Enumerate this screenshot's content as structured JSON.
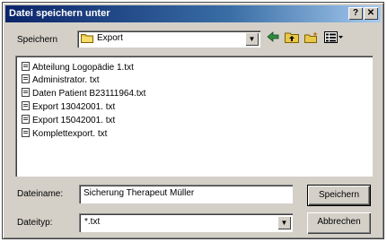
{
  "window": {
    "title": "Datei speichern unter",
    "help_label": "?",
    "close_label": "✕"
  },
  "location": {
    "label": "Speichern",
    "folder": "Export"
  },
  "toolbar": {
    "back_icon": "back-arrow-icon",
    "up_icon": "folder-up-icon",
    "new_folder_icon": "new-folder-icon",
    "view_menu_icon": "view-menu-icon"
  },
  "files": [
    {
      "name": "Abteilung Logopädie 1.txt"
    },
    {
      "name": "Administrator. txt"
    },
    {
      "name": "Daten Patient B23111964.txt"
    },
    {
      "name": "Export 13042001. txt"
    },
    {
      "name": "Export 15042001. txt"
    },
    {
      "name": "Komplettexport. txt"
    }
  ],
  "filename": {
    "label": "Dateiname:",
    "value": "Sicherung Therapeut Müller"
  },
  "filetype": {
    "label": "Dateityp:",
    "value": "*.txt"
  },
  "buttons": {
    "save": "Speichern",
    "cancel": "Abbrechen"
  },
  "colors": {
    "title_start": "#0a246a",
    "title_end": "#a6caf0",
    "face": "#d4d0c8"
  }
}
